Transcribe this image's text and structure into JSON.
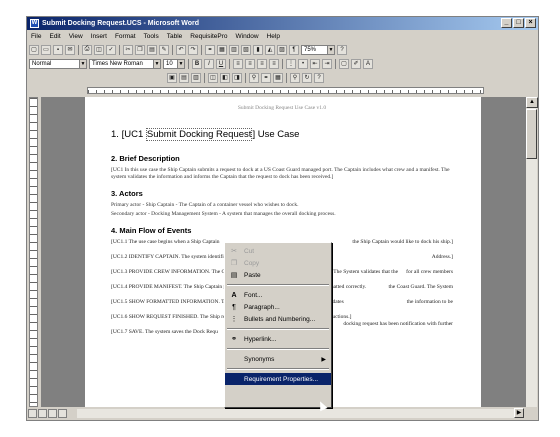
{
  "window": {
    "title": "Submit Docking Request.UCS - Microsoft Word"
  },
  "menu": [
    "File",
    "Edit",
    "View",
    "Insert",
    "Format",
    "Tools",
    "Table",
    "RequisitePro",
    "Window",
    "Help"
  ],
  "toolbar": {
    "zoom": "75%",
    "style": "Normal",
    "font": "Times New Roman",
    "size": "10"
  },
  "document": {
    "header": "Submit Docking Request Use Case v1.0",
    "title_num": "1.",
    "title_prefix": "[UC1 ",
    "title_field": "Submit Docking Request",
    "title_suffix": "] Use Case",
    "sec2": "2.   Brief Description",
    "sec2_text": "[UC1 In this use case the Ship Captain submits a request to dock at a US Coast Guard managed port. The Captain includes what crew and a manifest. The system validates the information and informs the Captain that the request to dock has been received.]",
    "sec3": "3.   Actors",
    "sec3_primary": "Primary actor - Ship Captain - The Captain of a container vessel who wishes to dock.",
    "sec3_secondary": "Secondary actor - Docking Management System - A system that manages the overall docking process.",
    "sec4": "4.   Main Flow of Events",
    "flows": [
      "[UC1.1 The use case begins when a Ship Captain",
      "[UC1.2 IDENTIFY CAPTAIN. The system identifies the Captain and",
      "[UC1.3 PROVIDE CREW INFORMATION. The Captain provides crew information about the ship. The System validates that the",
      "[UC1.4 PROVIDE MANIFEST. The Ship Captain provides the validates that the information is formatted correctly.",
      "[UC1.5 SHOW FORMATTED INFORMATION. The originally submitted and the Ship Captain validates",
      "[UC1.6 SHOW REQUEST FINISHED. The Ship received and provides a Dock Request Numb Instructions.]",
      "[UC1.7 SAVE. The system saves the Dock Requ"
    ],
    "flow_right": [
      "the Ship Captain would like to dock his ship.]",
      "Address.]",
      "for all crew members",
      "the Coast Guard. The System",
      "the information to be",
      "docking request has been notification with further"
    ]
  },
  "context_menu": {
    "items": [
      {
        "label": "Cut",
        "icon": "scissors-icon",
        "state": "disabled"
      },
      {
        "label": "Copy",
        "icon": "copy-icon",
        "state": "disabled"
      },
      {
        "label": "Paste",
        "icon": "paste-icon",
        "state": "normal"
      },
      {
        "label": "Font...",
        "icon": "font-icon",
        "state": "normal"
      },
      {
        "label": "Paragraph...",
        "icon": "paragraph-icon",
        "state": "normal"
      },
      {
        "label": "Bullets and Numbering...",
        "icon": "bullets-icon",
        "state": "normal"
      },
      {
        "label": "Hyperlink...",
        "icon": "hyperlink-icon",
        "state": "normal"
      },
      {
        "label": "Synonyms",
        "icon": "",
        "state": "submenu"
      },
      {
        "label": "Requirement Properties...",
        "icon": "",
        "state": "selected"
      }
    ]
  },
  "colors": {
    "titlebar": "#0a246a",
    "highlight": "#0a246a",
    "chrome": "#d4d0c8"
  }
}
